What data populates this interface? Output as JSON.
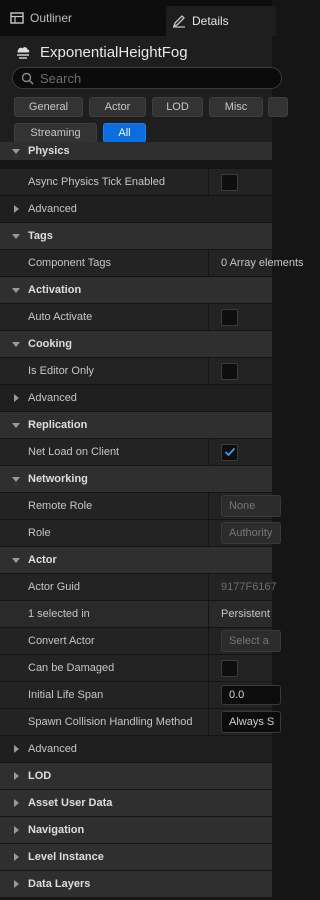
{
  "tabs": {
    "outliner": "Outliner",
    "details": "Details"
  },
  "header": {
    "actor_name": "ExponentialHeightFog",
    "search_placeholder": "Search"
  },
  "filters": [
    "General",
    "Actor",
    "LOD",
    "Misc",
    "",
    "Streaming",
    "All"
  ],
  "filter_active": "All",
  "categories": {
    "physics": "Physics",
    "tags": "Tags",
    "activation": "Activation",
    "cooking": "Cooking",
    "replication": "Replication",
    "networking": "Networking",
    "actor": "Actor",
    "lod": "LOD",
    "asset_user_data": "Asset User Data",
    "navigation": "Navigation",
    "level_instance": "Level Instance",
    "data_layers": "Data Layers"
  },
  "props": {
    "async_physics": "Async Physics Tick Enabled",
    "advanced": "Advanced",
    "component_tags": "Component Tags",
    "component_tags_value": "0 Array elements",
    "auto_activate": "Auto Activate",
    "is_editor_only": "Is Editor Only",
    "net_load_on_client": "Net Load on Client",
    "remote_role": "Remote Role",
    "remote_role_value": "None",
    "role": "Role",
    "role_value": "Authority",
    "actor_guid": "Actor Guid",
    "actor_guid_value": "9177F6167",
    "selected_in": "1 selected in",
    "selected_in_value": "Persistent",
    "convert_actor": "Convert Actor",
    "convert_actor_value": "Select a",
    "can_be_damaged": "Can be Damaged",
    "initial_life_span": "Initial Life Span",
    "initial_life_span_value": "0.0",
    "spawn_collision": "Spawn Collision Handling Method",
    "spawn_collision_value": "Always S"
  },
  "colors": {
    "accent": "#0a6ee0",
    "check": "#3a9cf5",
    "category_bg": "#2f2f2f",
    "row_bg": "#232323"
  }
}
